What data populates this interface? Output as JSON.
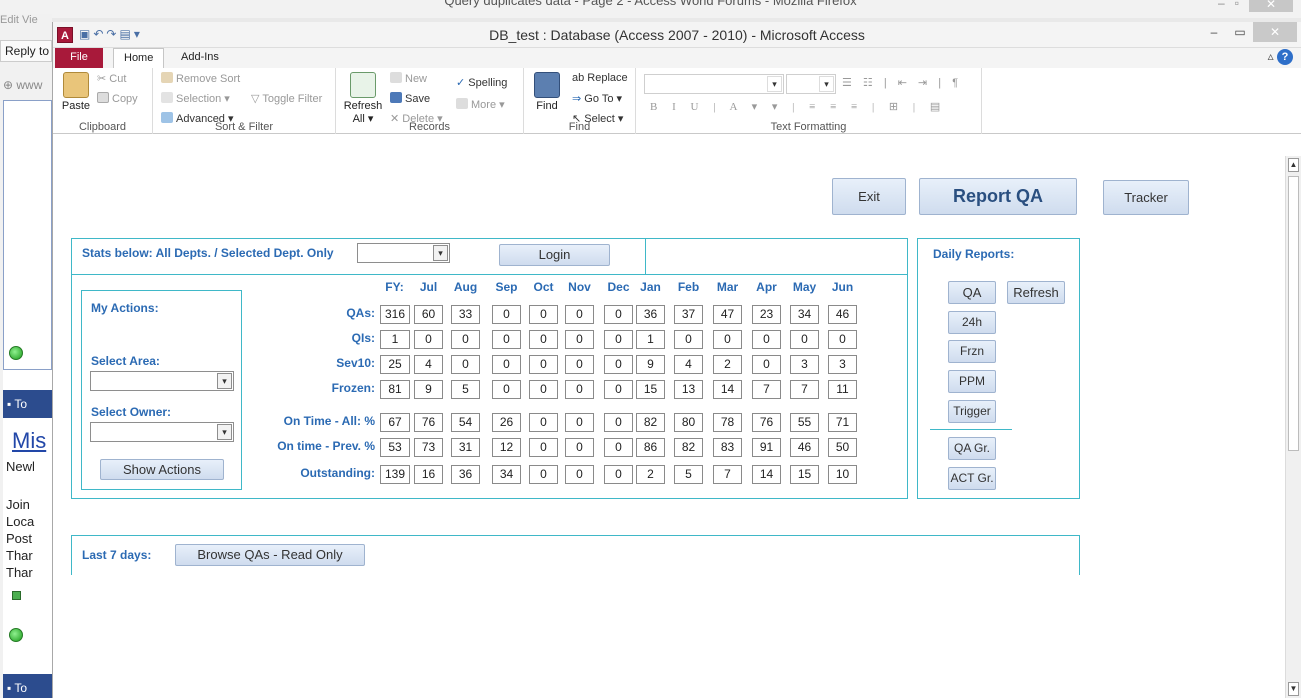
{
  "firefox": {
    "title": "Query duplicates data - Page 2 - Access World Forums - Mozilla Firefox",
    "menu": "Edit  Vie",
    "tab": "Reply to",
    "url": "www",
    "header_label": "To",
    "link": "Mis",
    "text_lines": [
      "Newl",
      "",
      "Join",
      "Loca",
      "Post",
      "Thar",
      "Thar"
    ]
  },
  "access": {
    "title": "DB_test : Database (Access 2007 - 2010)  -  Microsoft Access",
    "ribbon_tabs": [
      "File",
      "Home",
      "Add-Ins"
    ],
    "groups": {
      "clipboard": {
        "label": "Clipboard",
        "paste": "Paste",
        "cut": "Cut",
        "copy": "Copy"
      },
      "sort_filter": {
        "label": "Sort & Filter",
        "remove_sort": "Remove Sort",
        "selection": "Selection ▾",
        "advanced": "Advanced ▾",
        "toggle_filter": "Toggle Filter"
      },
      "records": {
        "label": "Records",
        "refresh_all": "Refresh All ▾",
        "new": "New",
        "save": "Save",
        "delete": "Delete ▾",
        "spelling": "Spelling",
        "more": "More ▾"
      },
      "find": {
        "label": "Find",
        "find": "Find",
        "replace": "Replace",
        "goto": "Go To ▾",
        "select": "Select ▾"
      },
      "text_formatting": {
        "label": "Text Formatting"
      }
    }
  },
  "form": {
    "buttons": {
      "exit": "Exit",
      "report_qa": "Report QA",
      "tracker": "Tracker",
      "login": "Login",
      "show_actions": "Show Actions",
      "browse_qas": "Browse QAs - Read Only"
    },
    "stats_label": "Stats below: All Depts. / Selected Dept. Only",
    "my_actions": "My Actions:",
    "select_area": "Select Area:",
    "select_owner": "Select Owner:",
    "last7": "Last 7 days:",
    "daily_reports": {
      "title": "Daily Reports:",
      "buttons": [
        "QA",
        "24h",
        "Frzn",
        "PPM",
        "Trigger",
        "QA Gr.",
        "ACT Gr."
      ],
      "refresh": "Refresh"
    },
    "columns": [
      "FY:",
      "Jul",
      "Aug",
      "Sep",
      "Oct",
      "Nov",
      "Dec",
      "Jan",
      "Feb",
      "Mar",
      "Apr",
      "May",
      "Jun"
    ],
    "rows": [
      {
        "label": "QAs:",
        "values": [
          "316",
          "60",
          "33",
          "0",
          "0",
          "0",
          "0",
          "36",
          "37",
          "47",
          "23",
          "34",
          "46"
        ]
      },
      {
        "label": "QIs:",
        "values": [
          "1",
          "0",
          "0",
          "0",
          "0",
          "0",
          "0",
          "1",
          "0",
          "0",
          "0",
          "0",
          "0"
        ]
      },
      {
        "label": "Sev10:",
        "values": [
          "25",
          "4",
          "0",
          "0",
          "0",
          "0",
          "0",
          "9",
          "4",
          "2",
          "0",
          "3",
          "3"
        ]
      },
      {
        "label": "Frozen:",
        "values": [
          "81",
          "9",
          "5",
          "0",
          "0",
          "0",
          "0",
          "15",
          "13",
          "14",
          "7",
          "7",
          "11"
        ]
      },
      {
        "label": "On Time - All: %",
        "values": [
          "67",
          "76",
          "54",
          "26",
          "0",
          "0",
          "0",
          "82",
          "80",
          "78",
          "76",
          "55",
          "71"
        ]
      },
      {
        "label": "On time - Prev. %",
        "values": [
          "53",
          "73",
          "31",
          "12",
          "0",
          "0",
          "0",
          "86",
          "82",
          "83",
          "91",
          "46",
          "50"
        ]
      },
      {
        "label": "Outstanding:",
        "values": [
          "139",
          "16",
          "36",
          "34",
          "0",
          "0",
          "0",
          "2",
          "5",
          "7",
          "14",
          "15",
          "10"
        ]
      }
    ]
  }
}
